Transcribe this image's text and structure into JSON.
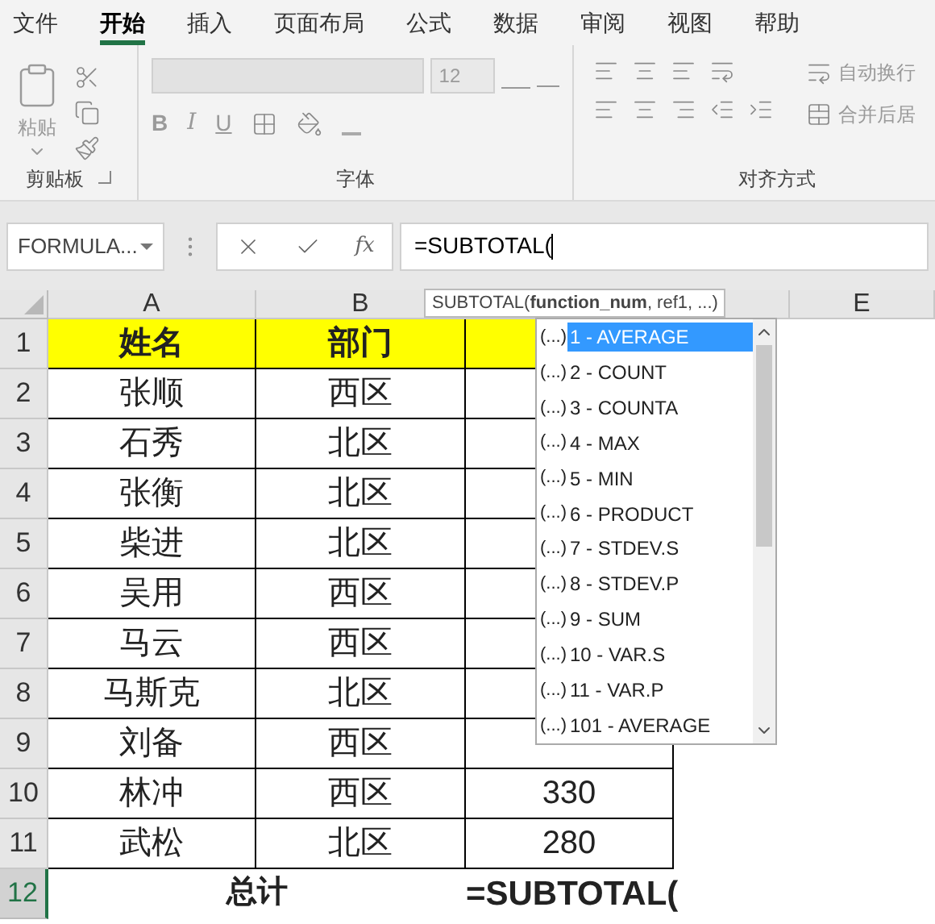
{
  "menu_tabs": [
    {
      "label": "文件",
      "selected": false
    },
    {
      "label": "开始",
      "selected": true
    },
    {
      "label": "插入",
      "selected": false
    },
    {
      "label": "页面布局",
      "selected": false
    },
    {
      "label": "公式",
      "selected": false
    },
    {
      "label": "数据",
      "selected": false
    },
    {
      "label": "审阅",
      "selected": false
    },
    {
      "label": "视图",
      "selected": false
    },
    {
      "label": "帮助",
      "selected": false
    }
  ],
  "ribbon": {
    "clipboard": {
      "paste_label": "粘贴",
      "group_label": "剪贴板"
    },
    "font": {
      "font_size": "12",
      "bold": "B",
      "italic": "I",
      "underline": "U",
      "group_label": "字体"
    },
    "alignment": {
      "wrap_text": "自动换行",
      "merge": "合并后居",
      "group_label": "对齐方式"
    }
  },
  "formula_bar": {
    "name_box": "FORMULA...",
    "insert_function": "fx",
    "value": "=SUBTOTAL("
  },
  "sheet": {
    "columns": [
      {
        "label": "A"
      },
      {
        "label": "B"
      },
      {},
      {},
      {
        "label": "E"
      }
    ],
    "rows": [
      {
        "number": "1",
        "kind": "header",
        "selected": false,
        "cells": [
          "姓名",
          "部门"
        ]
      },
      {
        "number": "2",
        "kind": "data",
        "selected": false,
        "cells": [
          "张顺",
          "西区"
        ]
      },
      {
        "number": "3",
        "kind": "data",
        "selected": false,
        "cells": [
          "石秀",
          "北区"
        ]
      },
      {
        "number": "4",
        "kind": "data",
        "selected": false,
        "cells": [
          "张衡",
          "北区"
        ]
      },
      {
        "number": "5",
        "kind": "data",
        "selected": false,
        "cells": [
          "柴进",
          "北区"
        ]
      },
      {
        "number": "6",
        "kind": "data",
        "selected": false,
        "cells": [
          "吴用",
          "西区"
        ]
      },
      {
        "number": "7",
        "kind": "data",
        "selected": false,
        "cells": [
          "马云",
          "西区"
        ]
      },
      {
        "number": "8",
        "kind": "data",
        "selected": false,
        "cells": [
          "马斯克",
          "北区"
        ]
      },
      {
        "number": "9",
        "kind": "data",
        "selected": false,
        "cells": [
          "刘备",
          "西区"
        ]
      },
      {
        "number": "10",
        "kind": "data",
        "selected": false,
        "cells": [
          "林冲",
          "西区",
          "330"
        ]
      },
      {
        "number": "11",
        "kind": "data",
        "selected": false,
        "cells": [
          "武松",
          "北区",
          "280"
        ]
      },
      {
        "number": "12",
        "kind": "total",
        "selected": true,
        "cells": [
          "总计",
          "",
          "=SUBTOTAL("
        ]
      }
    ]
  },
  "tooltip": "SUBTOTAL(**function_num**, ref1, ...)",
  "autocomplete": [
    {
      "prefix": "(...)",
      "label": "1 - AVERAGE",
      "selected": true
    },
    {
      "prefix": "(...)",
      "label": "2 - COUNT",
      "selected": false
    },
    {
      "prefix": "(...)",
      "label": "3 - COUNTA",
      "selected": false
    },
    {
      "prefix": "(...)",
      "label": "4 - MAX",
      "selected": false
    },
    {
      "prefix": "(...)",
      "label": "5 - MIN",
      "selected": false
    },
    {
      "prefix": "(...)",
      "label": "6 - PRODUCT",
      "selected": false
    },
    {
      "prefix": "(...)",
      "label": "7 - STDEV.S",
      "selected": false
    },
    {
      "prefix": "(...)",
      "label": "8 - STDEV.P",
      "selected": false
    },
    {
      "prefix": "(...)",
      "label": "9 - SUM",
      "selected": false
    },
    {
      "prefix": "(...)",
      "label": "10 - VAR.S",
      "selected": false
    },
    {
      "prefix": "(...)",
      "label": "11 - VAR.P",
      "selected": false
    },
    {
      "prefix": "(...)",
      "label": "101 - AVERAGE",
      "selected": false
    }
  ]
}
